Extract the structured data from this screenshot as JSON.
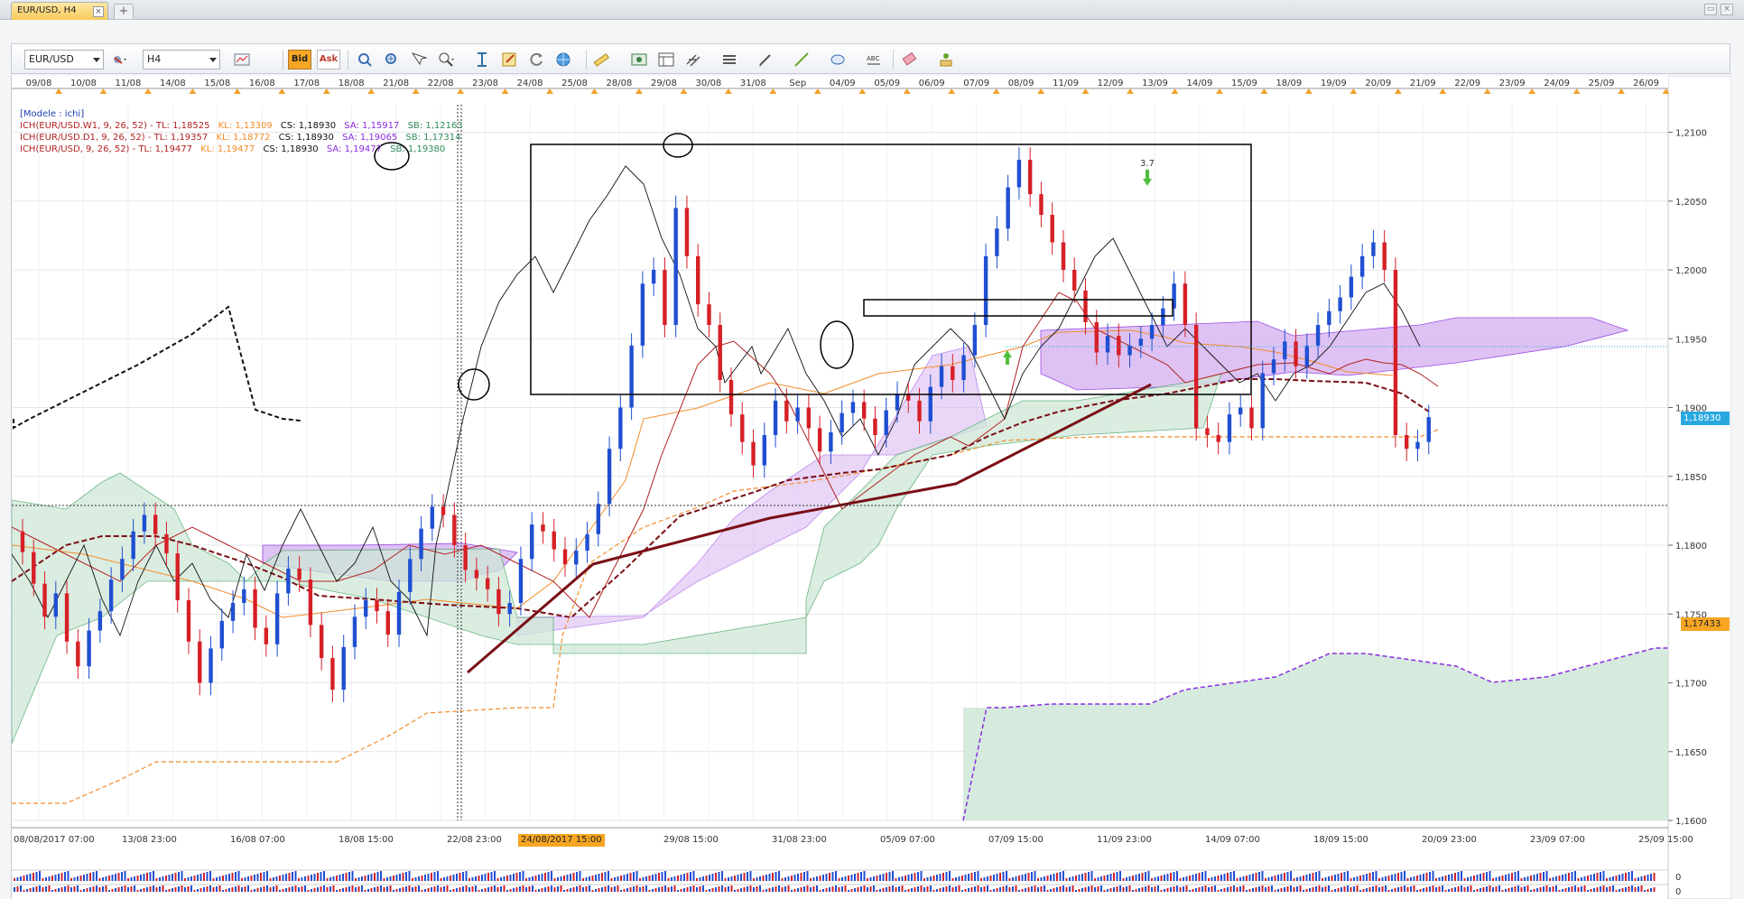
{
  "window": {
    "tab_label": "EUR/USD, H4",
    "tab_close": "×",
    "tab_add": "+",
    "min_label": "▭",
    "close_label": "×"
  },
  "toolbar": {
    "instrument": "EUR/USD",
    "period": "H4",
    "bid_label": "Bid",
    "ask_label": "Ask",
    "icons": [
      "chart-type-icon",
      "cursor-icon",
      "zoom-in-icon",
      "zoom-out-icon",
      "magnifier-icon",
      "indicator-icon",
      "template-icon",
      "refresh-icon",
      "globe-icon",
      "ruler-icon",
      "screenshot-icon",
      "layout-icon",
      "fib-icon",
      "lines-icon",
      "pen-icon",
      "trendline-icon",
      "shape-icon",
      "text-icon",
      "eraser-icon",
      "object-list-icon"
    ]
  },
  "legend": {
    "model": "[Modele : ichi]",
    "rows": [
      {
        "name": "ICH(EUR/USD.W1, 9, 26, 52) - ",
        "tl": "TL: 1,18525",
        "kl": "KL: 1,13309",
        "cs": "CS: 1,18930",
        "sa": "SA: 1,15917",
        "sb": "SB: 1,12163"
      },
      {
        "name": "ICH(EUR/USD.D1, 9, 26, 52) - ",
        "tl": "TL: 1,19357",
        "kl": "KL: 1,18772",
        "cs": "CS: 1,18930",
        "sa": "SA: 1,19065",
        "sb": "SB: 1,17314"
      },
      {
        "name": "ICH(EUR/USD, 9, 26, 52) - ",
        "tl": "TL: 1,19477",
        "kl": "KL: 1,19477",
        "cs": "CS: 1,18930",
        "sa": "SA: 1,19477",
        "sb": "SB: 1,19380"
      }
    ]
  },
  "price_tags": {
    "current": "1,18930",
    "crosshair": "1,17433"
  },
  "annotation_label": "3.7",
  "crosshair_date": "24/08/2017 15:00",
  "colors": {
    "bull": "#1f4fd1",
    "bear": "#d61f26",
    "tenkan": "#b22222",
    "kijun_w1": "#7a0f16",
    "cloud_green": "#cfe8d8",
    "cloud_purple": "#d9b8f2",
    "chikou": "#111111",
    "orange": "#f28c28",
    "current_tag": "#29a8e0",
    "crosshair_tag": "#f6a623"
  },
  "chart_data": {
    "type": "candlestick",
    "instrument": "EUR/USD",
    "timeframe": "H4",
    "ylim": [
      1.16,
      1.212
    ],
    "y_ticks": [
      "1,2100",
      "1,2050",
      "1,2000",
      "1,1950",
      "1,1900",
      "1,1850",
      "1,1800",
      "1,1750",
      "1,1700",
      "1,1650",
      "1,1600"
    ],
    "top_dates": [
      "09/08",
      "10/08",
      "11/08",
      "14/08",
      "15/08",
      "16/08",
      "17/08",
      "18/08",
      "21/08",
      "22/08",
      "23/08",
      "24/08",
      "25/08",
      "28/08",
      "29/08",
      "30/08",
      "31/08",
      "Sep",
      "04/09",
      "05/09",
      "06/09",
      "07/09",
      "08/09",
      "11/09",
      "12/09",
      "13/09",
      "14/09",
      "15/09",
      "18/09",
      "19/09",
      "20/09",
      "21/09",
      "22/09",
      "23/09",
      "24/09",
      "25/09",
      "26/09"
    ],
    "bottom_dates": [
      "08/08/2017 07:00",
      "13/08 23:00",
      "16/08 07:00",
      "18/08 15:00",
      "22/08 23:00",
      "24/08/2017 15:00",
      "29/08 15:00",
      "31/08 23:00",
      "05/09 07:00",
      "07/09 15:00",
      "11/09 23:00",
      "14/09 07:00",
      "18/09 15:00",
      "20/09 23:00",
      "23/09 07:00",
      "25/09 15:00"
    ],
    "candle_closes": [
      1.1795,
      1.1772,
      1.1748,
      1.1765,
      1.173,
      1.1712,
      1.1738,
      1.1752,
      1.1775,
      1.179,
      1.181,
      1.1822,
      1.1808,
      1.1794,
      1.176,
      1.173,
      1.17,
      1.1725,
      1.1745,
      1.1758,
      1.1768,
      1.174,
      1.1728,
      1.1765,
      1.1783,
      1.1775,
      1.1742,
      1.1718,
      1.1695,
      1.1726,
      1.1748,
      1.176,
      1.1752,
      1.1735,
      1.1766,
      1.179,
      1.1812,
      1.1828,
      1.1822,
      1.18,
      1.1782,
      1.1776,
      1.1768,
      1.175,
      1.1758,
      1.179,
      1.1815,
      1.181,
      1.1797,
      1.1786,
      1.1796,
      1.1808,
      1.183,
      1.187,
      1.19,
      1.1945,
      1.199,
      1.2,
      1.196,
      1.2045,
      1.201,
      1.1975,
      1.196,
      1.192,
      1.1895,
      1.1875,
      1.1858,
      1.188,
      1.1905,
      1.189,
      1.19,
      1.1885,
      1.1868,
      1.1882,
      1.1896,
      1.1904,
      1.1892,
      1.188,
      1.1898,
      1.191,
      1.1905,
      1.189,
      1.1915,
      1.193,
      1.192,
      1.1938,
      1.196,
      1.201,
      1.203,
      1.206,
      1.208,
      1.2055,
      1.204,
      1.202,
      1.2,
      1.1985,
      1.1962,
      1.194,
      1.1952,
      1.1938,
      1.1945,
      1.195,
      1.196,
      1.1972,
      1.199,
      1.196,
      1.1885,
      1.188,
      1.1875,
      1.1895,
      1.19,
      1.1885,
      1.1925,
      1.1935,
      1.1948,
      1.193,
      1.1945,
      1.196,
      1.197,
      1.198,
      1.1995,
      1.201,
      1.202,
      1.2,
      1.188,
      1.187,
      1.1875,
      1.1893
    ]
  }
}
